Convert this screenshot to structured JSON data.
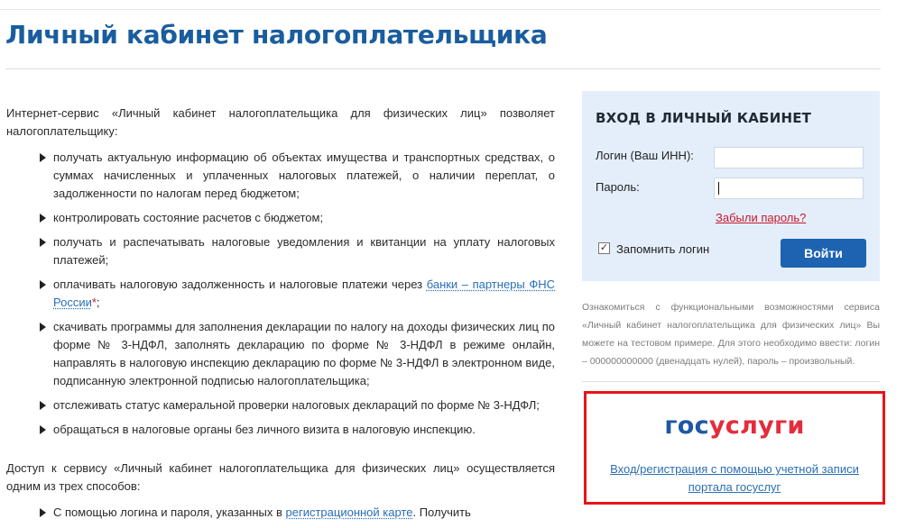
{
  "page": {
    "title": "Личный кабинет налогоплательщика"
  },
  "intro": {
    "text": "Интернет-сервис «Личный кабинет налогоплательщика для физических лиц» позволяет налогоплательщику:"
  },
  "bullets": [
    "получать актуальную информацию об объектах имущества и транспортных средствах, о суммах начисленных и уплаченных налоговых платежей, о наличии переплат, о задолженности по налогам перед бюджетом;",
    "контролировать состояние расчетов с бюджетом;",
    "получать и распечатывать налоговые уведомления и квитанции на уплату налоговых платежей;",
    {
      "before": "оплачивать налоговую задолженность и налоговые платежи через ",
      "link": "банки – партнеры ФНС России",
      "mark": "*",
      "after": ";"
    },
    "скачивать программы для заполнения декларации по налогу на доходы физических лиц по форме № 3-НДФЛ, заполнять декларацию по форме № 3-НДФЛ в режиме онлайн, направлять в налоговую инспекцию декларацию по форме № 3-НДФЛ в электронном виде, подписанную электронной подписью налогоплательщика;",
    "отслеживать статус камеральной проверки налоговых деклараций по форме № 3-НДФЛ;",
    "обращаться в налоговые органы без личного визита в налоговую инспекцию."
  ],
  "access": {
    "text": "Доступ к сервису «Личный кабинет налогоплательщика для физических лиц» осуществляется одним из трех способов:",
    "first_before": "С помощью логина и пароля, указанных в ",
    "first_link": "регистрационной карте",
    "first_after": ". Получить"
  },
  "login": {
    "heading": "ВХОД В ЛИЧНЫЙ КАБИНЕТ",
    "login_label": "Логин (Ваш ИНН):",
    "login_value": "",
    "password_label": "Пароль:",
    "password_value": "",
    "forgot": "Забыли пароль?",
    "remember_label": "Запомнить логин",
    "remember_checked": "✓",
    "submit": "Войти"
  },
  "test_note": "Ознакомиться с функциональными возможностями сервиса «Личный кабинет налогоплательщика для физических лиц» Вы можете на тестовом примере. Для этого необходимо ввести: логин – 000000000000 (двенадцать нулей), пароль – произвольный.",
  "gosuslugi": {
    "logo_part1": "гос",
    "logo_part2": "услуги",
    "link": "Вход/регистрация с помощью учетной записи портала госуслуг"
  },
  "colors": {
    "brand_blue": "#1a5d9e",
    "button_blue": "#1d63b1",
    "link_blue": "#2a6fb5",
    "alert_red": "#c8192c",
    "frame_red": "#e8141b",
    "login_panel_bg": "#e4eefa"
  },
  "icons": {
    "bullet": "arrow-right-icon",
    "checkbox": "checkmark-icon"
  }
}
